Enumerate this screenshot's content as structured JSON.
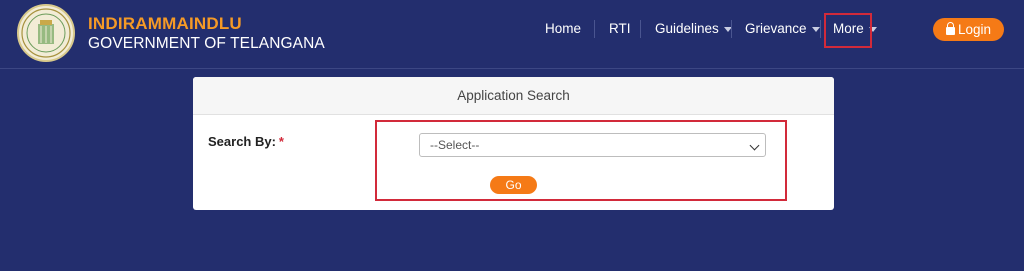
{
  "colors": {
    "background": "#232e6e",
    "accent": "#f57a16",
    "brand_title": "#f59a26",
    "highlight": "#d22a3a"
  },
  "header": {
    "emblem_icon": "telangana-emblem-logo",
    "title": "INDIRAMMAINDLU",
    "subtitle": "GOVERNMENT OF TELANGANA"
  },
  "nav": {
    "items": [
      {
        "label": "Home",
        "has_dropdown": false
      },
      {
        "label": "RTI",
        "has_dropdown": false
      },
      {
        "label": "Guidelines",
        "has_dropdown": true
      },
      {
        "label": "Grievance",
        "has_dropdown": true
      },
      {
        "label": "More",
        "has_dropdown": true
      }
    ],
    "login_label": "Login",
    "login_icon": "lock-icon"
  },
  "search_card": {
    "title": "Application Search",
    "field_label": "Search By:",
    "required_mark": "*",
    "select_value": "--Select--",
    "go_label": "Go"
  }
}
